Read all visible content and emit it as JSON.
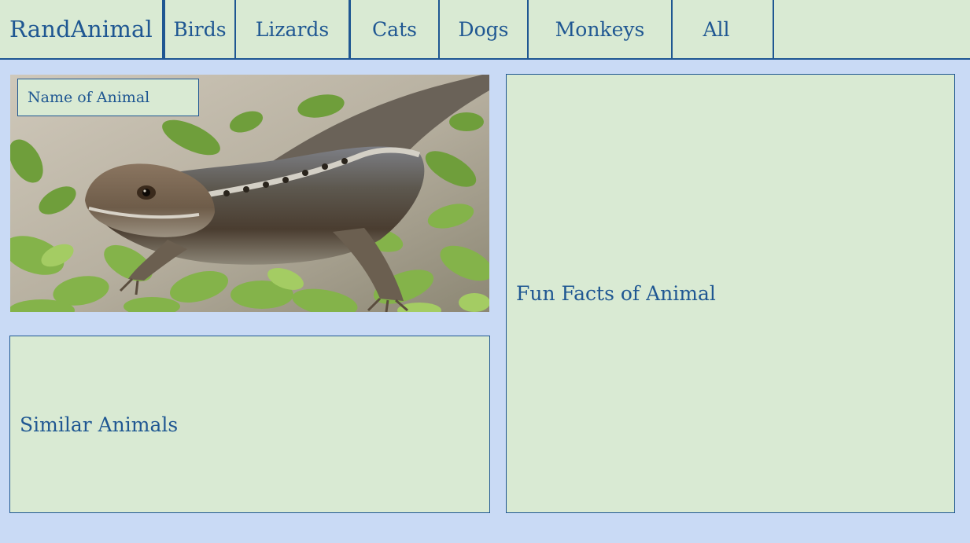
{
  "nav": {
    "brand": "RandAnimal",
    "tabs": [
      {
        "label": "Birds"
      },
      {
        "label": "Lizards"
      },
      {
        "label": "Cats"
      },
      {
        "label": "Dogs"
      },
      {
        "label": "Monkeys"
      },
      {
        "label": "All"
      }
    ]
  },
  "animal": {
    "name_label": "Name of Animal",
    "image_subject": "lizard-photo"
  },
  "similar": {
    "title": "Similar Animals"
  },
  "facts": {
    "title": "Fun Facts of Animal"
  },
  "colors": {
    "background": "#c9daf5",
    "panel": "#d9ead3",
    "accent": "#1f5792"
  }
}
